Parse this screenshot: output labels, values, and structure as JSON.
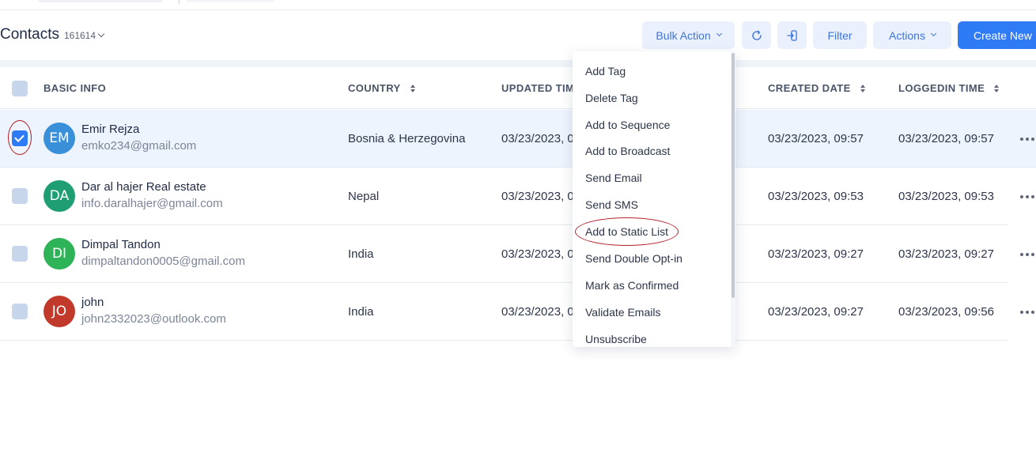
{
  "header": {
    "title": "Contacts",
    "count": "161614",
    "buttons": {
      "bulk_action": "Bulk Action",
      "filter": "Filter",
      "actions": "Actions",
      "create_new": "Create New"
    }
  },
  "table": {
    "columns": {
      "basic_info": "BASIC INFO",
      "country": "COUNTRY",
      "updated_time": "UPDATED TIME",
      "created_date": "CREATED DATE",
      "loggedin_time": "LOGGEDIN TIME"
    },
    "rows": [
      {
        "initials": "EM",
        "avatar_color": "#3a8fd9",
        "name": "Emir Rejza",
        "email": "emko234@gmail.com",
        "country": "Bosnia & Herzegovina",
        "updated": "03/23/2023, 0",
        "created": "03/23/2023, 09:57",
        "loggedin": "03/23/2023, 09:57",
        "selected": true
      },
      {
        "initials": "DA",
        "avatar_color": "#1f9e74",
        "name": "Dar al hajer Real estate",
        "email": "info.daralhajer@gmail.com",
        "country": "Nepal",
        "updated": "03/23/2023, 0",
        "created": "03/23/2023, 09:53",
        "loggedin": "03/23/2023, 09:53",
        "selected": false
      },
      {
        "initials": "DI",
        "avatar_color": "#2fb358",
        "name": "Dimpal Tandon",
        "email": "dimpaltandon0005@gmail.com",
        "country": "India",
        "updated": "03/23/2023, 0",
        "created": "03/23/2023, 09:27",
        "loggedin": "03/23/2023, 09:27",
        "selected": false
      },
      {
        "initials": "JO",
        "avatar_color": "#c0392b",
        "name": "john",
        "email": "john2332023@outlook.com",
        "country": "India",
        "updated": "03/23/2023, 0",
        "created": "03/23/2023, 09:27",
        "loggedin": "03/23/2023, 09:56",
        "selected": false
      }
    ]
  },
  "bulk_menu": {
    "items": [
      "Add Tag",
      "Delete Tag",
      "Add to Sequence",
      "Add to Broadcast",
      "Send Email",
      "Send SMS",
      "Add to Static List",
      "Send Double Opt-in",
      "Mark as Confirmed",
      "Validate Emails",
      "Unsubscribe"
    ]
  },
  "icons": {
    "refresh": "refresh-icon",
    "export": "export-icon",
    "row_more": "more-horizontal-icon"
  },
  "colors": {
    "accent": "#2f7af5",
    "button_bg": "#eaf1fd",
    "annotation": "#b0202a"
  }
}
